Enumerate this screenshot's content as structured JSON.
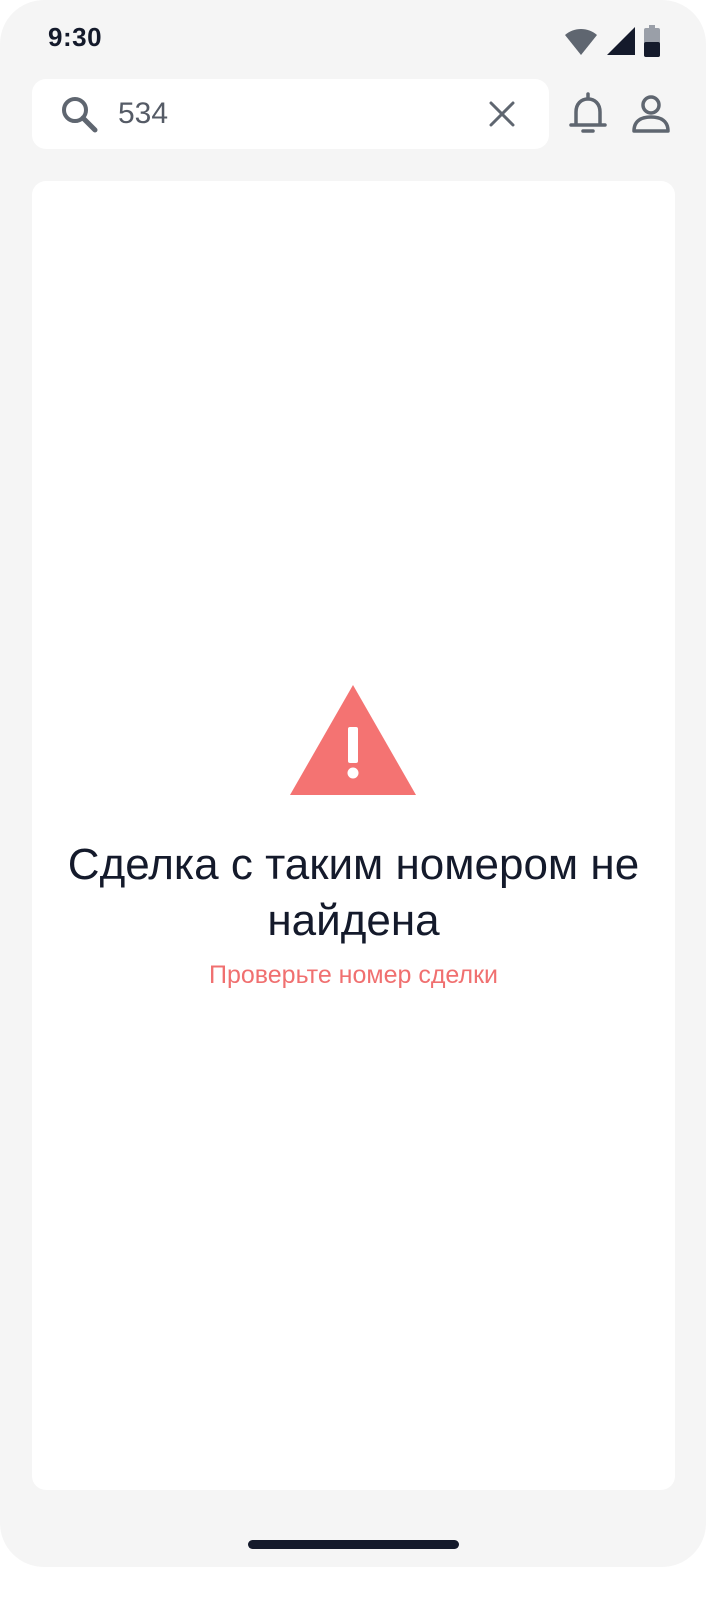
{
  "status_bar": {
    "time": "9:30",
    "icons": [
      "wifi-icon",
      "cellular-signal-icon",
      "battery-icon"
    ]
  },
  "search": {
    "value": "534",
    "icon": "search-icon",
    "clear_icon": "close-icon"
  },
  "header_actions": {
    "notifications_icon": "bell-icon",
    "profile_icon": "user-icon"
  },
  "error_state": {
    "icon": "warning-icon",
    "title": "Сделка с таким номером не найдена",
    "subtitle": "Проверьте номер сделки"
  },
  "colors": {
    "background": "#f5f5f5",
    "card": "#ffffff",
    "text_primary": "#141a2b",
    "icon_gray": "#5f6670",
    "accent_error": "#f47372"
  }
}
